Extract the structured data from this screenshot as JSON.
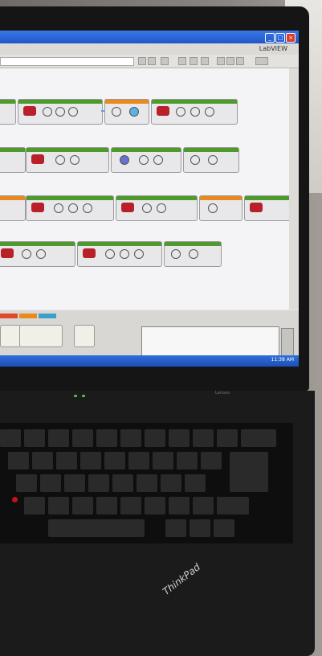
{
  "screen": {
    "brand": "LabVIEW",
    "clock": "11:38 AM"
  },
  "laptop": {
    "logo": "ThinkPad",
    "brand_small": "Lenovo"
  },
  "colors": {
    "accent_green": "#4f9a2d",
    "accent_orange": "#e98a1f",
    "titlebar_blue": "#2360d4",
    "motor_red": "#b8202a",
    "trackpoint_red": "#c0121d"
  }
}
